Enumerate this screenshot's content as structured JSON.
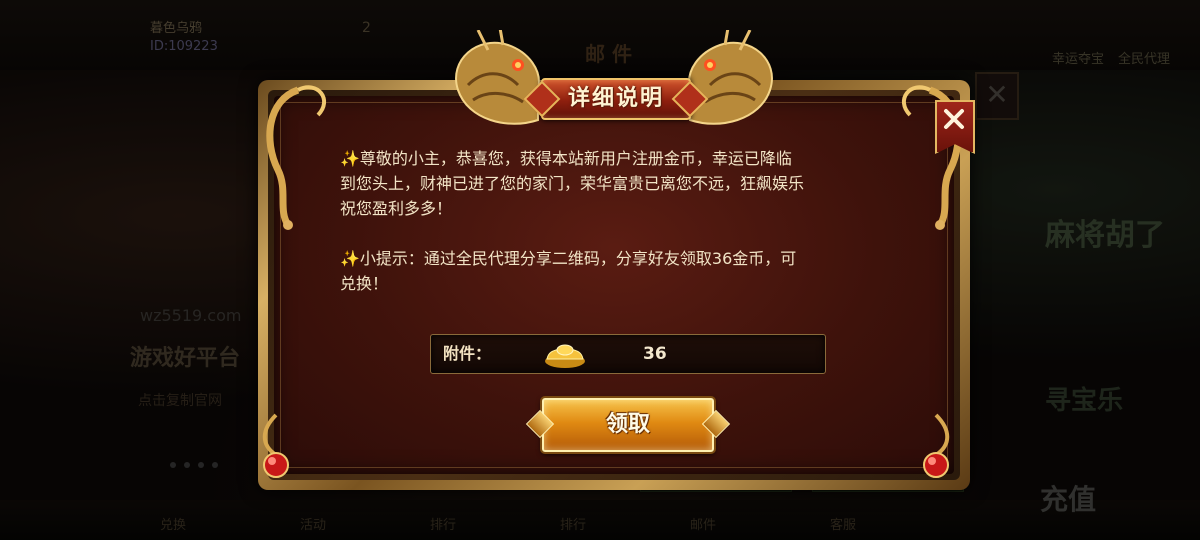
{
  "background": {
    "user_name": "暮色乌鸦",
    "user_id": "ID:109223",
    "top_number": "2",
    "top_links": [
      "幸运夺宝",
      "全民代理"
    ],
    "mail_tab": "邮 件",
    "site_text": "wz5519.com",
    "promo_title": "游戏好平台",
    "promo_sub": "点击复制官网",
    "right_title_1": "麻将胡了",
    "right_title_2": "寻宝乐",
    "recharge_label": "充值",
    "bottom_nav": [
      "兑换",
      "活动",
      "排行",
      "排行",
      "邮件",
      "客服"
    ]
  },
  "dialog": {
    "title": "详细说明",
    "message_line1": "✨尊敬的小主，恭喜您，获得本站新用户注册金币，幸运已降临",
    "message_line2": "到您头上，财神已进了您的家门，荣华富贵已离您不远，狂飙娱乐",
    "message_line3": "祝您盈利多多！",
    "tip_line1": "✨小提示：通过全民代理分享二维码，分享好友领取36金币，可",
    "tip_line2": "兑换！",
    "attachment_label": "附件：",
    "attachment_amount": "36",
    "claim_label": "领取"
  },
  "colors": {
    "panel_red": "#4a150d",
    "gold": "#d8b064",
    "text": "#f2e4c6",
    "button_orange": "#e08a12"
  },
  "icons": [
    "close-icon",
    "gold-ingot-icon",
    "dragon-ornament",
    "red-jewel-ornament"
  ]
}
